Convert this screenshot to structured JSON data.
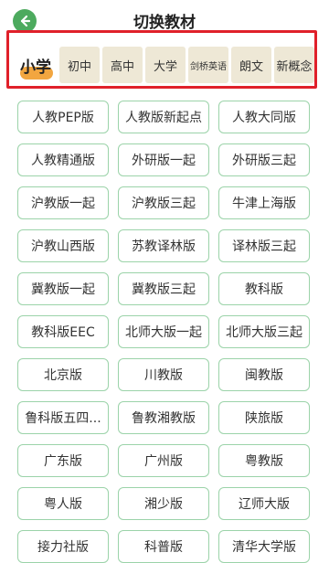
{
  "header": {
    "title": "切换教材"
  },
  "tabs": [
    {
      "label": "小学",
      "active": true
    },
    {
      "label": "初中"
    },
    {
      "label": "高中"
    },
    {
      "label": "大学"
    },
    {
      "label": "剑桥英语"
    },
    {
      "label": "朗文"
    },
    {
      "label": "新概念"
    }
  ],
  "books": [
    "人教PEP版",
    "人教版新起点",
    "人教大同版",
    "人教精通版",
    "外研版一起",
    "外研版三起",
    "沪教版一起",
    "沪教版三起",
    "牛津上海版",
    "沪教山西版",
    "苏教译林版",
    "译林版三起",
    "冀教版一起",
    "冀教版三起",
    "教科版",
    "教科版EEC",
    "北师大版一起",
    "北师大版三起",
    "北京版",
    "川教版",
    "闽教版",
    "鲁科版五四...",
    "鲁教湘教版",
    "陕旅版",
    "广东版",
    "广州版",
    "粤教版",
    "粤人版",
    "湘少版",
    "辽师大版",
    "接力社版",
    "科普版",
    "清华大学版"
  ],
  "colors": {
    "accent": "#4daa5e",
    "highlight_frame": "#e0202a",
    "tab_bg": "#eee8d6",
    "active_underline": "#f2a640",
    "book_border": "#9bd3a9"
  }
}
